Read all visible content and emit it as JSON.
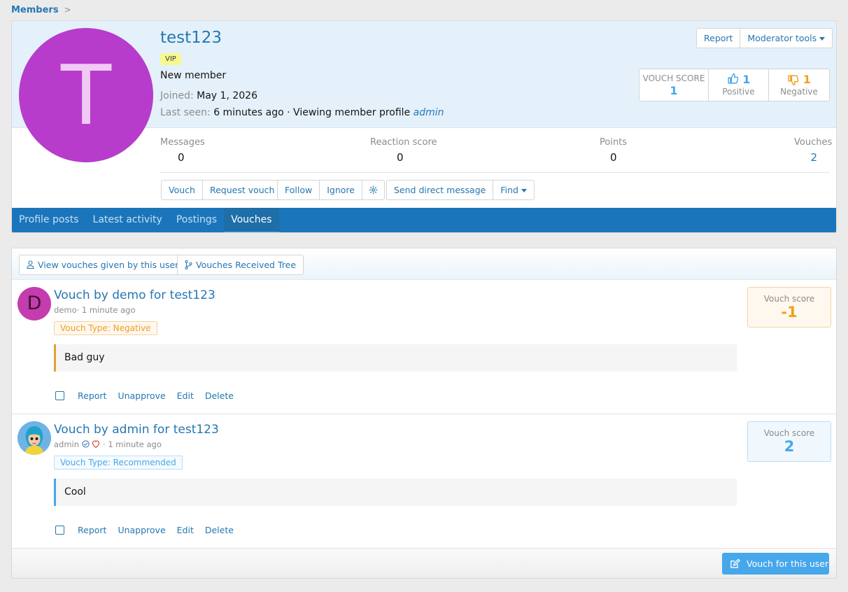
{
  "breadcrumb": {
    "label": "Members",
    "chevron": ">"
  },
  "profile": {
    "avatar_letter": "T",
    "username": "test123",
    "badge": "VIP",
    "user_title": "New member",
    "joined_label": "Joined:",
    "joined_value": "May 1, 2026",
    "lastseen_label": "Last seen:",
    "lastseen_value": "6 minutes ago · Viewing member profile",
    "lastseen_viewer": "admin",
    "report_label": "Report",
    "moderator_tools_label": "Moderator tools",
    "vouch_score_label": "VOUCH SCORE",
    "vouch_score_value": "1",
    "positive_count": "1",
    "positive_label": "Positive",
    "negative_count": "1",
    "negative_label": "Negative",
    "stats": [
      {
        "label": "Messages",
        "value": "0"
      },
      {
        "label": "Reaction score",
        "value": "0"
      },
      {
        "label": "Points",
        "value": "0"
      },
      {
        "label": "Vouches",
        "value": "2"
      }
    ],
    "actions": {
      "vouch": "Vouch",
      "request_vouch": "Request vouch",
      "follow": "Follow",
      "ignore": "Ignore",
      "send_dm": "Send direct message",
      "find": "Find"
    },
    "tabs": [
      "Profile posts",
      "Latest activity",
      "Postings",
      "Vouches"
    ],
    "active_tab": "Vouches"
  },
  "vouches": {
    "toolbar": {
      "given_label": "View vouches given by this user",
      "tree_label": "Vouches Received Tree"
    },
    "items": [
      {
        "avatar_letter": "D",
        "title": "Vouch by demo for test123",
        "author": "demo",
        "time": "· 1 minute ago",
        "type": "Vouch Type: Negative",
        "message": "Bad guy",
        "score_label": "Vouch score",
        "score": "-1"
      },
      {
        "avatar_letter": "",
        "title": "Vouch by admin for test123",
        "author": "admin",
        "time": "· 1 minute ago",
        "type": "Vouch Type: Recommended",
        "message": "Cool",
        "score_label": "Vouch score",
        "score": "2"
      }
    ],
    "item_actions": {
      "report": "Report",
      "unapprove": "Unapprove",
      "edit": "Edit",
      "delete": "Delete"
    },
    "vouch_for_user_label": "Vouch for this user"
  },
  "colors": {
    "accent": "#2577b1",
    "tab_bar": "#1b75ba",
    "negative": "#f19e1d",
    "positive": "#47a7eb",
    "avatar_main": "#b73ccc"
  }
}
